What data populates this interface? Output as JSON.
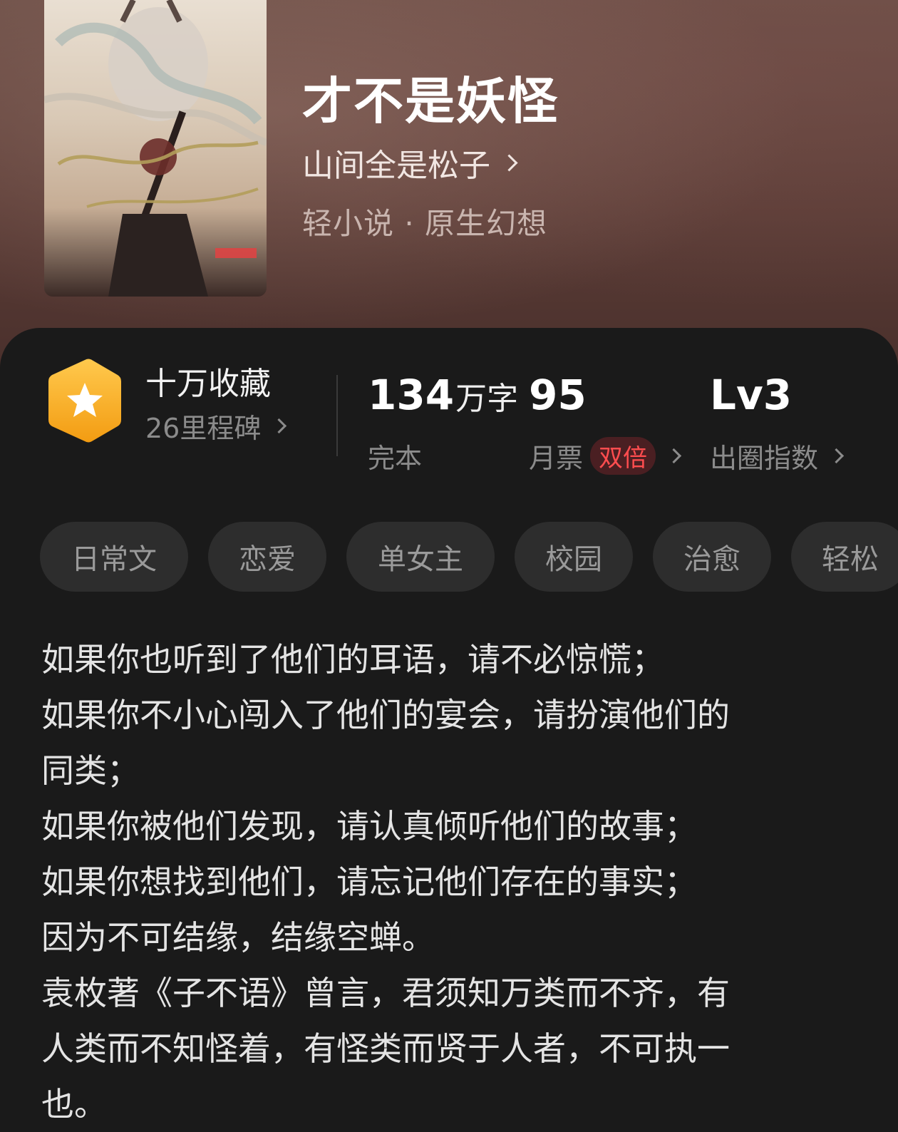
{
  "book": {
    "title": "才不是妖怪",
    "author": "山间全是松子",
    "genre": "轻小说 · 原生幻想"
  },
  "stats": {
    "collect_title": "十万收藏",
    "collect_sub": "26里程碑",
    "words_value": "134",
    "words_unit": "万字",
    "words_label": "完本",
    "monthly_value": "95",
    "monthly_label": "月票",
    "monthly_badge": "双倍",
    "level_value": "Lv3",
    "level_label": "出圈指数"
  },
  "tags": [
    "日常文",
    "恋爱",
    "单女主",
    "校园",
    "治愈",
    "轻松"
  ],
  "description": [
    "如果你也听到了他们的耳语，请不必惊慌；",
    "如果你不小心闯入了他们的宴会，请扮演他们的",
    "同类；",
    "如果你被他们发现，请认真倾听他们的故事；",
    "如果你想找到他们，请忘记他们存在的事实；",
    "因为不可结缘，结缘空蝉。",
    "袁枚著《子不语》曾言，君须知万类而不齐，有",
    "人类而不知怪着，有怪类而贤于人者，不可执一",
    "也。"
  ],
  "colors": {
    "accent_red": "#ff4d4f",
    "badge_gold": "#f6b93b",
    "panel_bg": "#1a1a1a"
  }
}
